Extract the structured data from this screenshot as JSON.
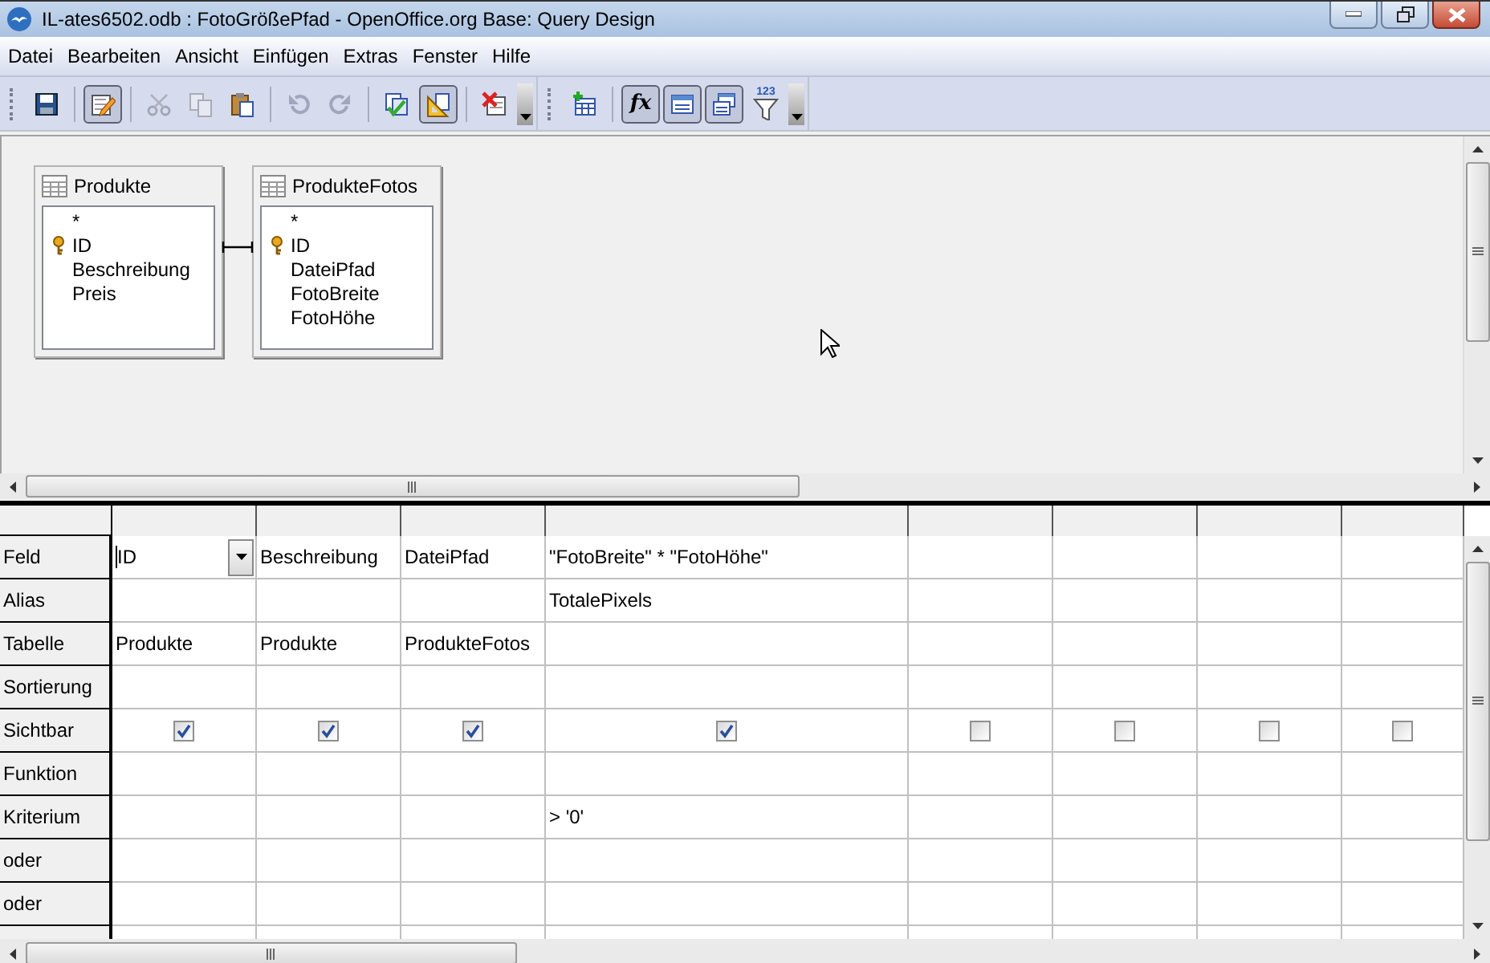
{
  "window": {
    "title": "IL-ates6502.odb : FotoGrößePfad - OpenOffice.org Base: Query Design"
  },
  "menu": [
    "Datei",
    "Bearbeiten",
    "Ansicht",
    "Einfügen",
    "Extras",
    "Fenster",
    "Hilfe"
  ],
  "toolbars": [
    {
      "items": [
        {
          "kind": "grip"
        },
        {
          "kind": "button",
          "pressed": false,
          "disabled": false
        },
        {
          "kind": "separator"
        },
        {
          "kind": "button",
          "pressed": true,
          "disabled": false
        },
        {
          "kind": "separator"
        },
        {
          "kind": "button",
          "pressed": false,
          "disabled": true
        },
        {
          "kind": "button",
          "pressed": false,
          "disabled": true
        },
        {
          "kind": "button",
          "pressed": false,
          "disabled": false
        },
        {
          "kind": "separator"
        },
        {
          "kind": "button",
          "pressed": false,
          "disabled": true
        },
        {
          "kind": "button",
          "pressed": false,
          "disabled": true
        },
        {
          "kind": "separator"
        },
        {
          "kind": "button",
          "pressed": false,
          "disabled": false
        },
        {
          "kind": "button",
          "pressed": true,
          "disabled": false
        },
        {
          "kind": "separator"
        },
        {
          "kind": "button",
          "pressed": false,
          "disabled": false
        },
        {
          "kind": "overflow"
        }
      ]
    },
    {
      "items": [
        {
          "kind": "grip"
        },
        {
          "kind": "button",
          "pressed": false,
          "disabled": false
        },
        {
          "kind": "separator"
        },
        {
          "kind": "button",
          "pressed": true,
          "disabled": false,
          "glyph": "fx"
        },
        {
          "kind": "button",
          "pressed": true,
          "disabled": false
        },
        {
          "kind": "button",
          "pressed": true,
          "disabled": false
        },
        {
          "kind": "button",
          "pressed": false,
          "disabled": false,
          "glyph": "123"
        },
        {
          "kind": "overflow"
        }
      ]
    }
  ],
  "tables": [
    {
      "name": "Produkte",
      "fields": [
        {
          "name": "*",
          "primary_key": false
        },
        {
          "name": "ID",
          "primary_key": true
        },
        {
          "name": "Beschreibung",
          "primary_key": false
        },
        {
          "name": "Preis",
          "primary_key": false
        }
      ]
    },
    {
      "name": "ProdukteFotos",
      "fields": [
        {
          "name": "*",
          "primary_key": false
        },
        {
          "name": "ID",
          "primary_key": true
        },
        {
          "name": "DateiPfad",
          "primary_key": false
        },
        {
          "name": "FotoBreite",
          "primary_key": false
        },
        {
          "name": "FotoHöhe",
          "primary_key": false
        }
      ]
    }
  ],
  "grid": {
    "rows": [
      {
        "label": "Feld",
        "kind": "field"
      },
      {
        "label": "Alias",
        "kind": "alias"
      },
      {
        "label": "Tabelle",
        "kind": "table"
      },
      {
        "label": "Sortierung",
        "kind": "sort"
      },
      {
        "label": "Sichtbar",
        "kind": "visible"
      },
      {
        "label": "Funktion",
        "kind": "function"
      },
      {
        "label": "Kriterium",
        "kind": "criterion"
      },
      {
        "label": "oder",
        "kind": "or"
      },
      {
        "label": "oder",
        "kind": "or"
      }
    ],
    "columns": [
      {
        "selected": true,
        "field": "ID",
        "table": "Produkte",
        "visible": true
      },
      {
        "selected": false,
        "field": "Beschreibung",
        "table": "Produkte",
        "visible": true
      },
      {
        "selected": false,
        "field": "DateiPfad",
        "table": "ProdukteFotos",
        "visible": true
      },
      {
        "selected": false,
        "field": "\"FotoBreite\" * \"FotoHöhe\"",
        "alias": "TotalePixels",
        "criterion": "> '0'",
        "visible": true
      },
      {
        "selected": false,
        "visible": false
      },
      {
        "selected": false,
        "visible": false
      },
      {
        "selected": false,
        "visible": false
      },
      {
        "selected": false,
        "visible": false
      }
    ]
  }
}
